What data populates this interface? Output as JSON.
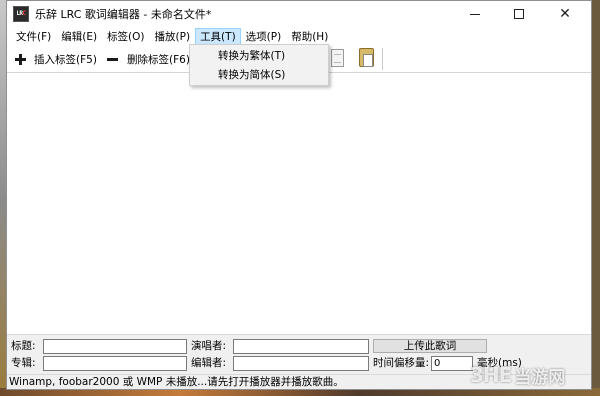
{
  "window": {
    "app_icon_text_a": "LR",
    "app_icon_text_b": "C",
    "title": "乐辞 LRC 歌词编辑器 - 未命名文件*",
    "minimize_symbol": "",
    "close_symbol": "✕"
  },
  "menubar": {
    "items": [
      {
        "label": "文件(F)"
      },
      {
        "label": "编辑(E)"
      },
      {
        "label": "标签(O)"
      },
      {
        "label": "播放(P)"
      },
      {
        "label": "工具(T)",
        "active": true
      },
      {
        "label": "选项(P)"
      },
      {
        "label": "帮助(H)"
      }
    ]
  },
  "toolbar": {
    "insert_label": "插入标签(F5)",
    "delete_label": "删除标签(F6)"
  },
  "tools_menu": {
    "items": [
      {
        "label": "转换为繁体(T)"
      },
      {
        "label": "转换为简体(S)"
      }
    ]
  },
  "editor": {
    "content": ""
  },
  "form": {
    "title_label": "标题:",
    "title_value": "",
    "singer_label": "演唱者:",
    "singer_value": "",
    "upload_label": "上传此歌词",
    "album_label": "专辑:",
    "album_value": "",
    "editor_label": "编辑者:",
    "editor_value": "",
    "offset_label": "时间偏移量:",
    "offset_value": "0",
    "offset_unit": "毫秒(ms)"
  },
  "status": {
    "text": "Winamp, foobar2000 或 WMP 未播放...请先打开播放器并播放歌曲。"
  },
  "watermark": {
    "logo": "3HE",
    "site": "当游网"
  }
}
